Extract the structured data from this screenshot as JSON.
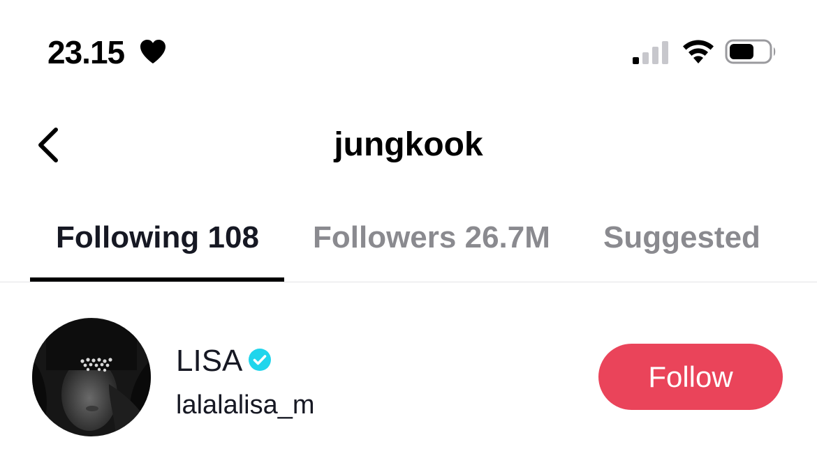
{
  "status_bar": {
    "time": "23.15",
    "heart_icon": "heart-icon",
    "signal_icon": "cellular-signal-icon",
    "wifi_icon": "wifi-icon",
    "battery_icon": "battery-icon",
    "signal_bars_filled": 1,
    "signal_bars_total": 4,
    "battery_level": 0.5
  },
  "header": {
    "back_icon": "chevron-left-icon",
    "title": "jungkook"
  },
  "tabs": [
    {
      "label": "Following 108",
      "active": true
    },
    {
      "label": "Followers 26.7M",
      "active": false
    },
    {
      "label": "Suggested",
      "active": false
    }
  ],
  "user_list": [
    {
      "display_name": "LISA",
      "verified": true,
      "verified_icon": "verified-check-icon",
      "username": "lalalalisa_m",
      "follow_label": "Follow"
    }
  ],
  "colors": {
    "follow_button": "#ea445a",
    "verified_badge": "#20d5ec",
    "tab_active": "#161823",
    "tab_inactive": "#8a8a8f",
    "divider": "#e4e4e6"
  }
}
